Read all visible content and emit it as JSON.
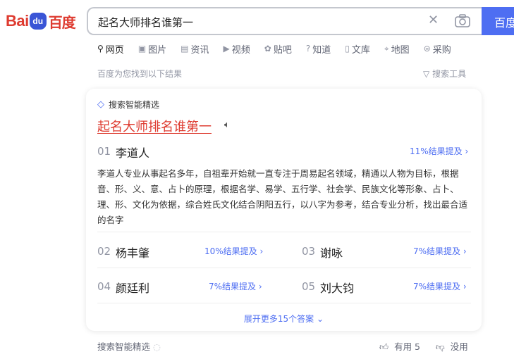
{
  "logo": {
    "latin_left": "Bai",
    "paw": "du",
    "chinese": "百度"
  },
  "search": {
    "query": "起名大师排名谁第一",
    "button_label": "百度"
  },
  "tabs": [
    {
      "label": "网页",
      "icon": "search-icon"
    },
    {
      "label": "图片",
      "icon": "image-icon"
    },
    {
      "label": "资讯",
      "icon": "news-icon"
    },
    {
      "label": "视频",
      "icon": "video-icon"
    },
    {
      "label": "贴吧",
      "icon": "tieba-icon"
    },
    {
      "label": "知道",
      "icon": "question-icon"
    },
    {
      "label": "文库",
      "icon": "doc-icon"
    },
    {
      "label": "地图",
      "icon": "map-icon"
    },
    {
      "label": "采购",
      "icon": "purchase-icon"
    }
  ],
  "results_meta": {
    "count_text": "百度为您找到以下结果",
    "tools_label": "搜索工具"
  },
  "card": {
    "badge": "搜索智能精选",
    "title": "起名大师排名谁第一",
    "items": [
      {
        "rank": "01",
        "name": "李道人",
        "mention": "11%结果提及"
      },
      {
        "rank": "02",
        "name": "杨丰肇",
        "mention": "10%结果提及"
      },
      {
        "rank": "03",
        "name": "谢咏",
        "mention": "7%结果提及"
      },
      {
        "rank": "04",
        "name": "颜廷利",
        "mention": "7%结果提及"
      },
      {
        "rank": "05",
        "name": "刘大钧",
        "mention": "7%结果提及"
      }
    ],
    "description": "李道人专业从事起名多年，自祖辈开始就一直专注于周易起名领域，精通以人物为目标，根据音、形、义、意、占卜的原理，根据名学、易学、五行学、社会学、民族文化等形象、占卜、理、形、文化为依据，综合姓氏文化结合阴阳五行，以八字为参考，结合专业分析，找出最合适的名字",
    "expand_label": "展开更多15个答案"
  },
  "footer": {
    "source": "搜索智能精选",
    "useful": "有用 5",
    "useless": "没用"
  },
  "colors": {
    "accent": "#4e6ef2",
    "title_red": "#de3b30",
    "logo_blue": "#3a55d6"
  }
}
